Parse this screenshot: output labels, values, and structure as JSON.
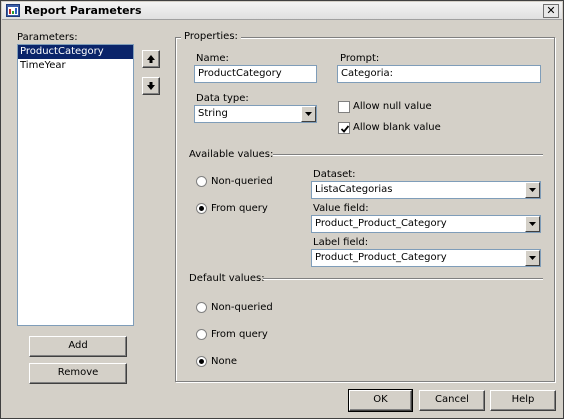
{
  "window": {
    "title": "Report Parameters",
    "close_glyph": "✕"
  },
  "parameters": {
    "label": "Parameters:",
    "items": [
      "ProductCategory",
      "TimeYear"
    ],
    "selected": "ProductCategory",
    "add_label": "Add",
    "remove_label": "Remove"
  },
  "properties": {
    "group_title": "Properties:",
    "name_label": "Name:",
    "name_value": "ProductCategory",
    "prompt_label": "Prompt:",
    "prompt_value": "Categoria:",
    "datatype_label": "Data type:",
    "datatype_value": "String",
    "allow_null_label": "Allow null value",
    "allow_null_checked": false,
    "allow_blank_label": "Allow blank value",
    "allow_blank_checked": true
  },
  "available_values": {
    "section_label": "Available values:",
    "non_queried_label": "Non-queried",
    "from_query_label": "From query",
    "selected": "from_query",
    "dataset_label": "Dataset:",
    "dataset_value": "ListaCategorias",
    "value_field_label": "Value field:",
    "value_field_value": "Product_Product_Category",
    "label_field_label": "Label field:",
    "label_field_value": "Product_Product_Category"
  },
  "default_values": {
    "section_label": "Default values:",
    "non_queried_label": "Non-queried",
    "from_query_label": "From query",
    "none_label": "None",
    "selected": "none"
  },
  "footer": {
    "ok_label": "OK",
    "cancel_label": "Cancel",
    "help_label": "Help"
  },
  "icons": {
    "move_up": "arrow-up-icon",
    "move_down": "arrow-down-icon",
    "app": "report-parameters-icon",
    "dropdown": "chevron-down-icon"
  }
}
